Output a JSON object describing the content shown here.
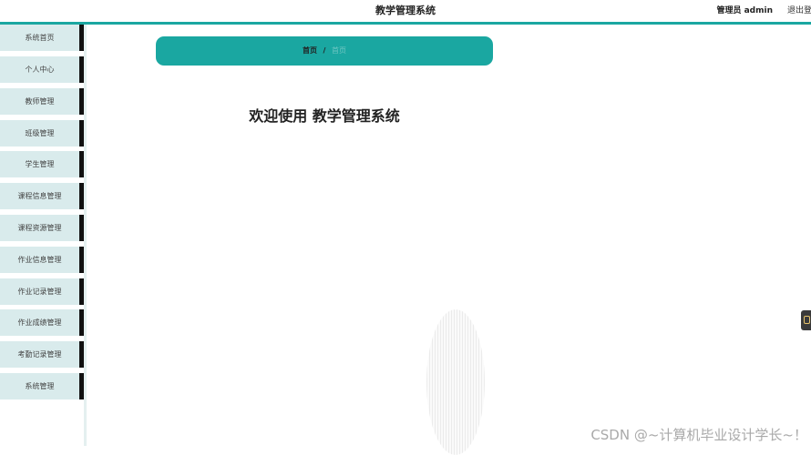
{
  "header": {
    "title": "教学管理系统",
    "user_label": "管理员 admin",
    "logout_label": "退出登录"
  },
  "sidebar": {
    "items": [
      {
        "label": "系统首页"
      },
      {
        "label": "个人中心"
      },
      {
        "label": "教师管理"
      },
      {
        "label": "班级管理"
      },
      {
        "label": "学生管理"
      },
      {
        "label": "课程信息管理"
      },
      {
        "label": "课程资源管理"
      },
      {
        "label": "作业信息管理"
      },
      {
        "label": "作业记录管理"
      },
      {
        "label": "作业成绩管理"
      },
      {
        "label": "考勤记录管理"
      },
      {
        "label": "系统管理"
      }
    ]
  },
  "breadcrumb": {
    "home": "首页",
    "separator": "/",
    "current": "首页"
  },
  "main": {
    "welcome": "欢迎使用 教学管理系统"
  },
  "watermark": "CSDN @~计算机毕业设计学长~！",
  "colors": {
    "accent": "#1aa7a1",
    "sidebar_bg": "#d9ebec",
    "sidebar_marker": "#111111"
  }
}
